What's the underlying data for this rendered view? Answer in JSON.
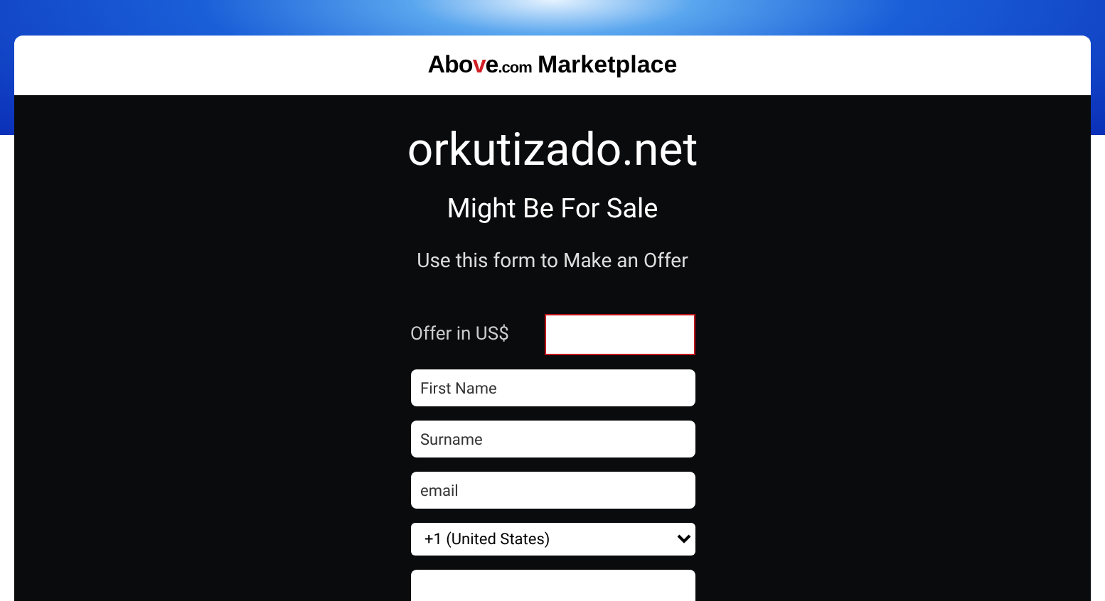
{
  "header": {
    "logo": [
      {
        "text": "Abo",
        "kind": "plain"
      },
      {
        "text": "v",
        "kind": "accent"
      },
      {
        "text": "e",
        "kind": "plain"
      },
      {
        "text": ".com",
        "kind": "small"
      }
    ],
    "title": "Marketplace"
  },
  "domain": "orkutizado.net",
  "subtitle": "Might Be For Sale",
  "instruction": "Use this form to Make an Offer",
  "offer": {
    "label": "Offer in US$",
    "invalid": true
  },
  "fields": [
    {
      "placeholder": "First Name"
    },
    {
      "placeholder": "Surname"
    },
    {
      "placeholder": "email"
    }
  ],
  "phone_code": {
    "value": "+1 (United States)"
  }
}
